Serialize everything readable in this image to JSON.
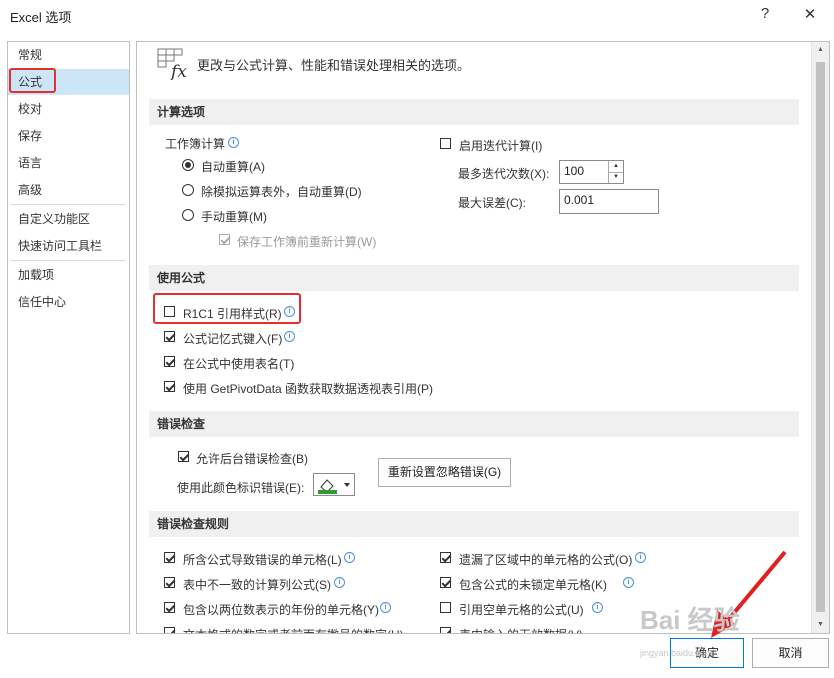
{
  "window": {
    "title": "Excel 选项",
    "help": "?",
    "close": "✕"
  },
  "sidebar": {
    "items": [
      {
        "label": "常规"
      },
      {
        "label": "公式"
      },
      {
        "label": "校对"
      },
      {
        "label": "保存"
      },
      {
        "label": "语言"
      },
      {
        "label": "高级"
      },
      {
        "label": "自定义功能区"
      },
      {
        "label": "快速访问工具栏"
      },
      {
        "label": "加载项"
      },
      {
        "label": "信任中心"
      }
    ],
    "selected": "公式"
  },
  "header": {
    "description": "更改与公式计算、性能和错误处理相关的选项。"
  },
  "calc": {
    "section": "计算选项",
    "workbook_calc": "工作簿计算",
    "auto": "自动重算(A)",
    "auto_except_tables": "除模拟运算表外，自动重算(D)",
    "manual": "手动重算(M)",
    "recalc_before_save": "保存工作簿前重新计算(W)",
    "iterative": "启用迭代计算(I)",
    "max_iterations_label": "最多迭代次数(X):",
    "max_iterations": "100",
    "max_change_label": "最大误差(C):",
    "max_change": "0.001"
  },
  "formulas": {
    "section": "使用公式",
    "r1c1": "R1C1 引用样式(R)",
    "autocomplete": "公式记忆式键入(F)",
    "table_names": "在公式中使用表名(T)",
    "getpivotdata": "使用 GetPivotData 函数获取数据透视表引用(P)"
  },
  "error_checking": {
    "section": "错误检查",
    "enable_background": "允许后台错误检查(B)",
    "color_label": "使用此颜色标识错误(E):",
    "reset_button": "重新设置忽略错误(G)"
  },
  "rules": {
    "section": "错误检查规则",
    "items": [
      {
        "label": "所含公式导致错误的单元格(L)",
        "checked": true
      },
      {
        "label": "遗漏了区域中的单元格的公式(O)",
        "checked": true
      },
      {
        "label": "表中不一致的计算列公式(S)",
        "checked": true
      },
      {
        "label": "包含公式的未锁定单元格(K)",
        "checked": true
      },
      {
        "label": "包含以两位数表示的年份的单元格(Y)",
        "checked": true
      },
      {
        "label": "引用空单元格的公式(U)",
        "checked": false
      },
      {
        "label": "文本格式的数字或者前面有撇号的数字(H)",
        "checked": true
      },
      {
        "label": "表中输入的无效数据(V)",
        "checked": true
      }
    ]
  },
  "footer": {
    "ok": "确定",
    "cancel": "取消"
  },
  "watermark": {
    "text": "Bai 经验",
    "url": "jingyan.baidu.com"
  },
  "colors": {
    "highlight": "#e03030",
    "selection": "#cde6f7",
    "section_bg": "#f0f0f0"
  }
}
